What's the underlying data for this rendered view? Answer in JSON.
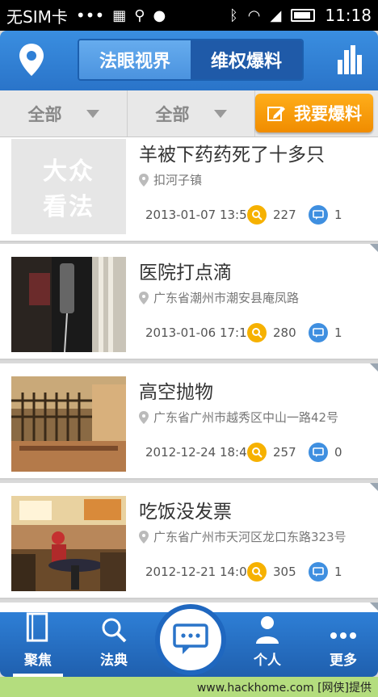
{
  "statusbar": {
    "carrier": "无SIM卡",
    "dots": "•••",
    "time": "11:18"
  },
  "header": {
    "tabs": [
      {
        "label": "法眼视界",
        "active": false
      },
      {
        "label": "维权爆料",
        "active": true
      }
    ]
  },
  "filters": [
    {
      "label": "全部"
    },
    {
      "label": "全部"
    }
  ],
  "report_button": {
    "label": "我要爆料"
  },
  "placeholder_logo": {
    "line1": "大众",
    "line2": "看法"
  },
  "items": [
    {
      "title": "羊被下药药死了十多只",
      "address": "扣河子镇",
      "date": "2013-01-07 13:55",
      "views": "227",
      "comments": "1"
    },
    {
      "title": "医院打点滴",
      "address": "广东省潮州市潮安县庵凤路",
      "date": "2013-01-06 17:18",
      "views": "280",
      "comments": "1"
    },
    {
      "title": "高空抛物",
      "address": "广东省广州市越秀区中山一路42号",
      "date": "2012-12-24 18:46",
      "views": "257",
      "comments": "0"
    },
    {
      "title": "吃饭没发票",
      "address": "广东省广州市天河区龙口东路323号",
      "date": "2012-12-21 14:03",
      "views": "305",
      "comments": "1"
    }
  ],
  "bottom_nav": [
    {
      "label": "聚焦",
      "active": true
    },
    {
      "label": "法典",
      "active": false
    },
    {
      "label": "个人",
      "active": false
    },
    {
      "label": "更多",
      "active": false
    }
  ],
  "footer": {
    "text": "www.hackhome.com [网侠]提供"
  },
  "colors": {
    "brand_blue": "#2a74c9",
    "accent_orange": "#f29200"
  }
}
